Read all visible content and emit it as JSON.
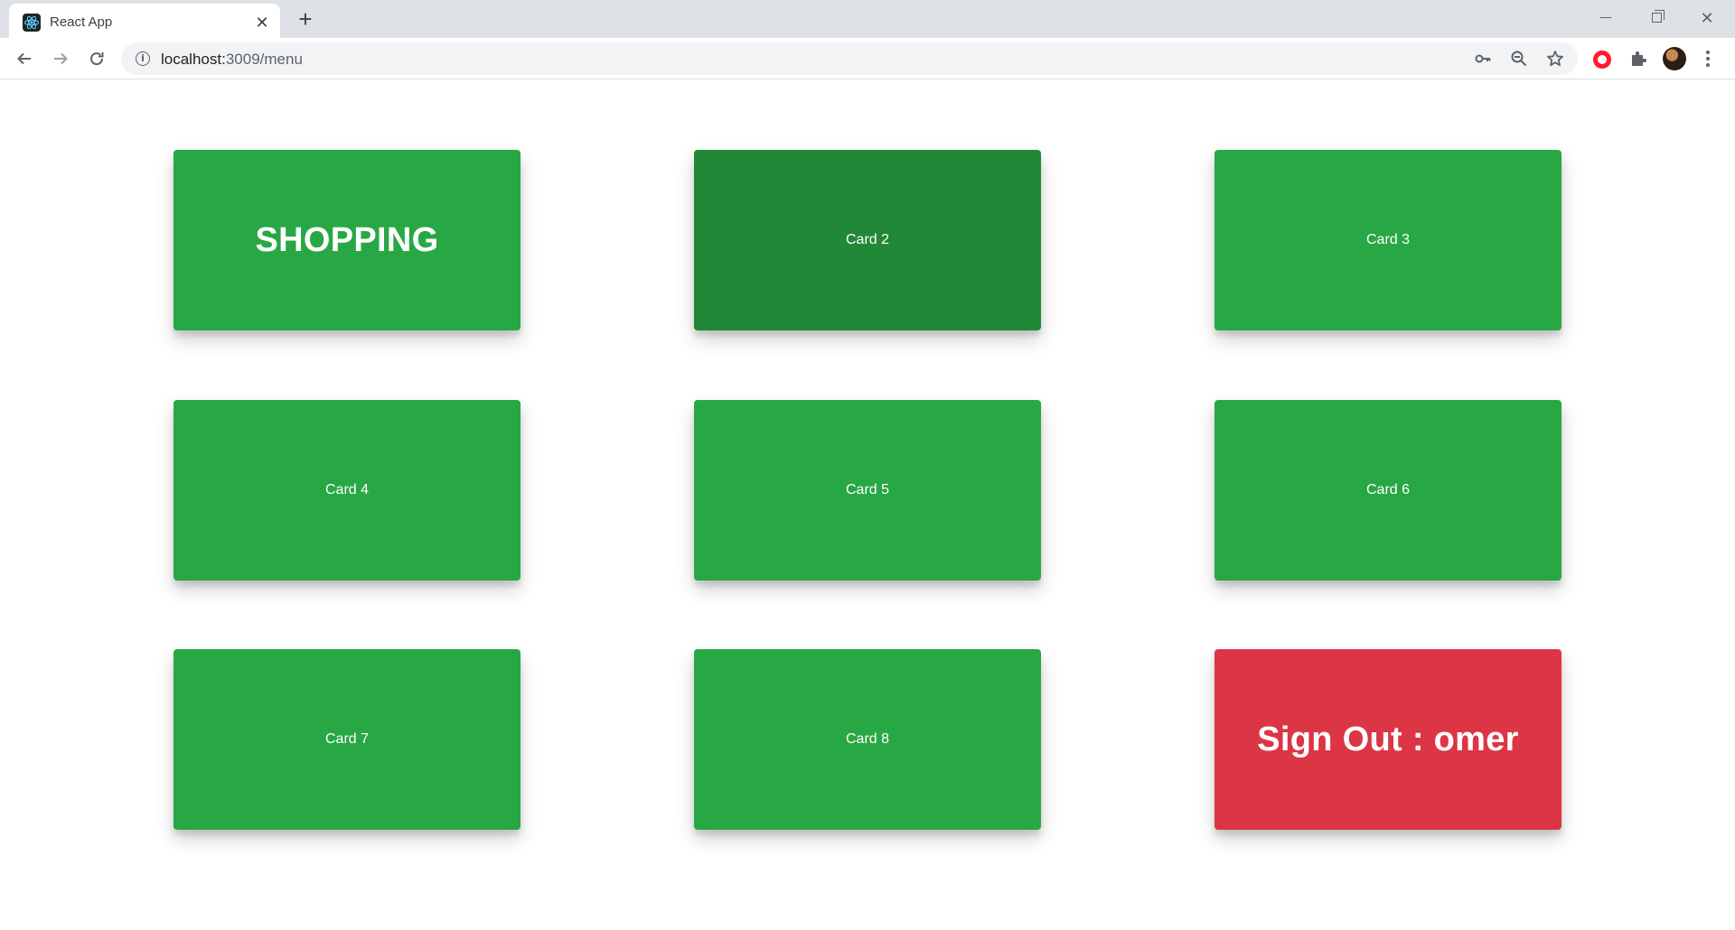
{
  "browser": {
    "tab": {
      "title": "React App",
      "favicon": "react-logo-icon",
      "close_glyph": "✕"
    },
    "new_tab_glyph": "+",
    "window_controls": {
      "close_glyph": "✕"
    },
    "address": {
      "host": "localhost:",
      "port_path": "3009/menu"
    },
    "toolbar_icons": [
      "back-arrow-icon",
      "forward-arrow-icon",
      "reload-icon",
      "info-icon",
      "key-icon",
      "zoom-out-icon",
      "star-icon",
      "opera-icon",
      "puzzle-icon",
      "avatar",
      "kebab-menu-icon"
    ]
  },
  "menu": {
    "cards": [
      {
        "label": "SHOPPING",
        "style": "big",
        "color": "#28a745"
      },
      {
        "label": "Card 2",
        "style": "normal",
        "color": "#218838",
        "state": "hovered"
      },
      {
        "label": "Card 3",
        "style": "normal",
        "color": "#28a745"
      },
      {
        "label": "Card 4",
        "style": "normal",
        "color": "#28a745"
      },
      {
        "label": "Card 5",
        "style": "normal",
        "color": "#28a745"
      },
      {
        "label": "Card 6",
        "style": "normal",
        "color": "#28a745"
      },
      {
        "label": "Card 7",
        "style": "normal",
        "color": "#28a745"
      },
      {
        "label": "Card 8",
        "style": "normal",
        "color": "#28a745"
      },
      {
        "label": "Sign Out : omer",
        "style": "big",
        "color": "#dc3545"
      }
    ]
  }
}
